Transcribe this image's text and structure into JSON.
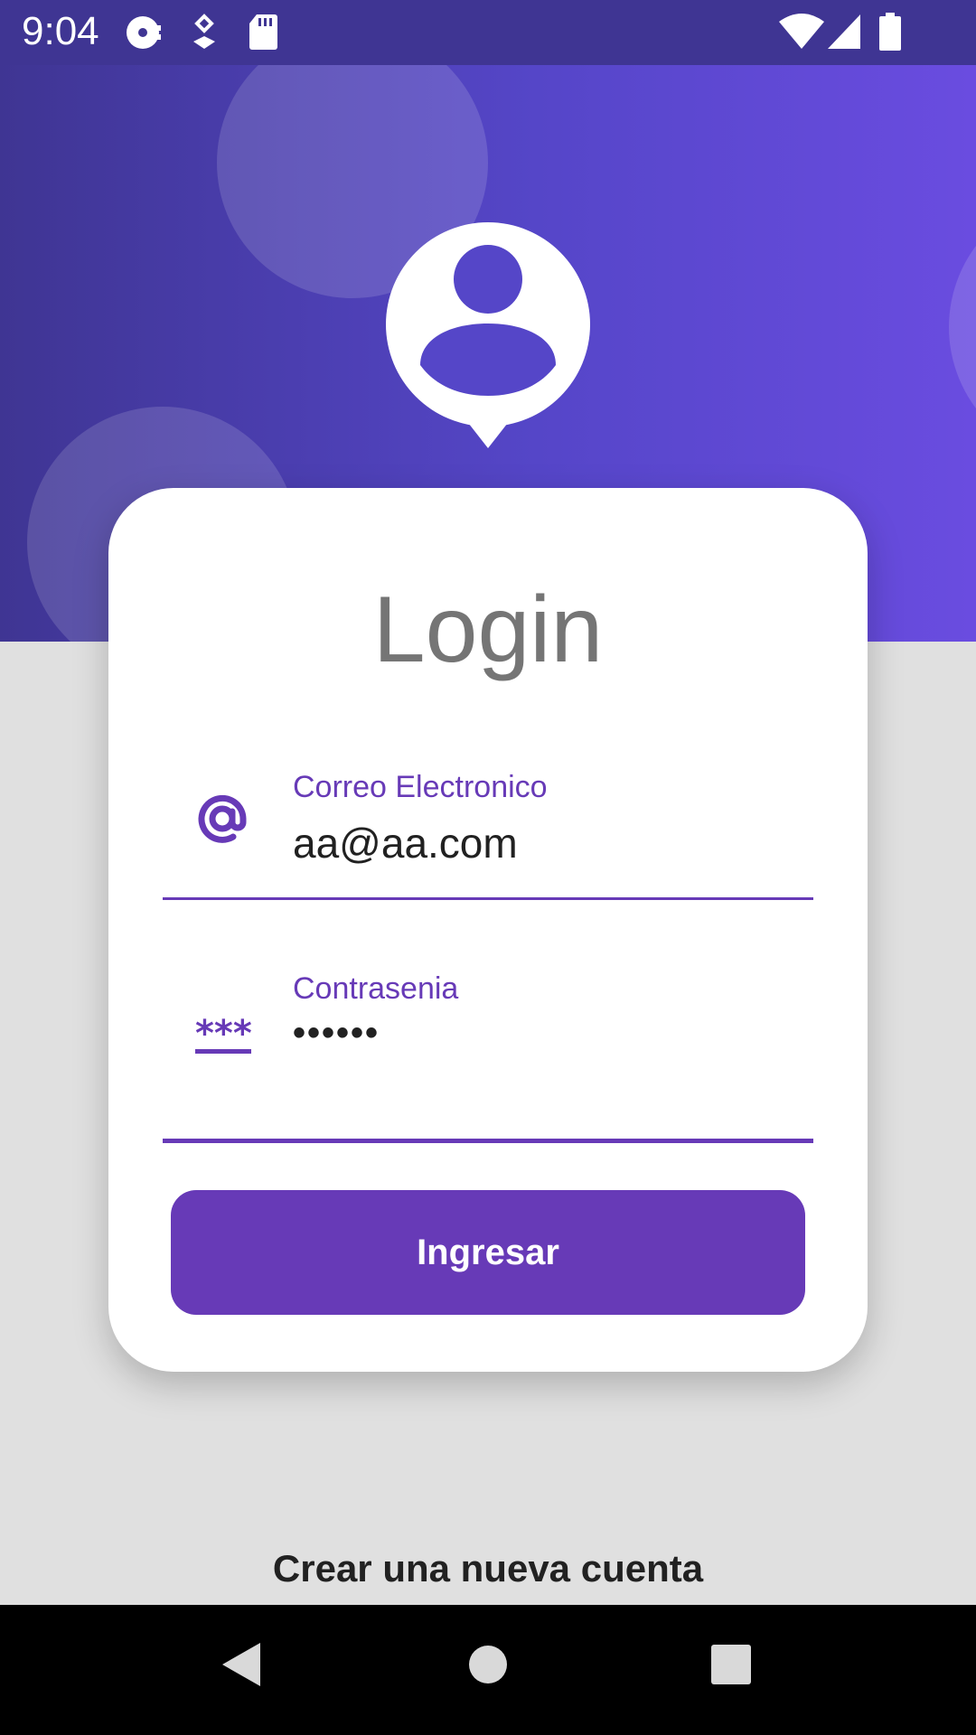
{
  "status_bar": {
    "time": "9:04",
    "left_icons": [
      "media-icon",
      "location-icon",
      "sd-card-icon"
    ],
    "right_icons": [
      "wifi-icon",
      "signal-icon",
      "battery-icon"
    ]
  },
  "header": {
    "avatar_icon": "user-pin-icon",
    "colors": {
      "start": "#3f3593",
      "end": "#6a4ce0"
    }
  },
  "login_card": {
    "title": "Login",
    "email": {
      "label": "Correo Electronico",
      "value": "aa@aa.com",
      "icon": "at-sign-icon"
    },
    "password": {
      "label": "Contrasenia",
      "value": "••••••",
      "icon": "password-icon"
    },
    "submit_label": "Ingresar"
  },
  "create_account_label": "Crear una nueva cuenta",
  "nav_bar": {
    "buttons": [
      "back-icon",
      "home-icon",
      "recents-icon"
    ]
  },
  "colors": {
    "accent": "#673ab7",
    "background": "#e0e0e0"
  }
}
